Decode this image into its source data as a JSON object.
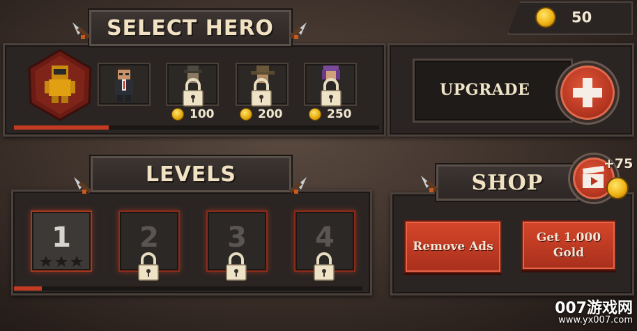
{
  "currency": {
    "gold": "50",
    "icon": "gold-coin-icon"
  },
  "select_hero": {
    "title": "SELECT HERO",
    "heroes": [
      {
        "name": "yellow-suit-hero",
        "selected": true,
        "locked": false,
        "price": ""
      },
      {
        "name": "suit-agent-hero",
        "selected": false,
        "locked": false,
        "price": ""
      },
      {
        "name": "hat-hero",
        "selected": false,
        "locked": true,
        "price": "100"
      },
      {
        "name": "cowboy-hat-hero",
        "selected": false,
        "locked": true,
        "price": "200"
      },
      {
        "name": "purple-hair-hero",
        "selected": false,
        "locked": true,
        "price": "250"
      }
    ],
    "progress": 0.26
  },
  "upgrade": {
    "label": "UPGRADE",
    "icon": "plus-icon"
  },
  "levels": {
    "title": "LEVELS",
    "items": [
      {
        "number": "1",
        "locked": false,
        "stars": 0
      },
      {
        "number": "2",
        "locked": true
      },
      {
        "number": "3",
        "locked": true
      },
      {
        "number": "4",
        "locked": true
      }
    ],
    "progress": 0.08
  },
  "shop": {
    "title": "SHOP",
    "video_reward": "+75",
    "remove_ads_label": "Remove Ads",
    "get_gold_label": "Get 1.000 Gold"
  },
  "watermark": {
    "brand": "007游戏网",
    "url": "www.yx007.com"
  },
  "colors": {
    "accent": "#c23a22",
    "panel": "#2a2523",
    "text": "#efe3c8",
    "gold": "#f2b51a"
  }
}
